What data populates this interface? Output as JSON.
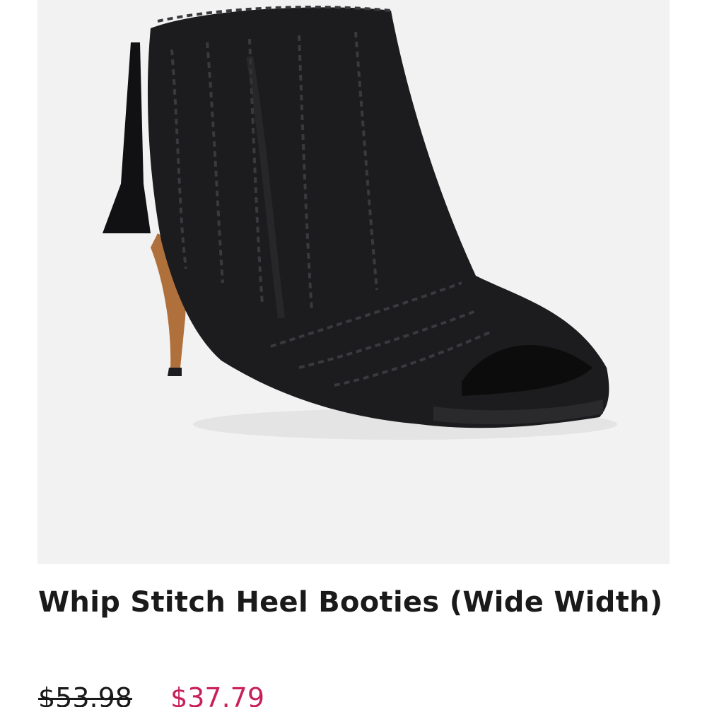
{
  "product": {
    "title": "Whip Stitch Heel Booties (Wide Width)",
    "image": {
      "name": "black-peep-toe-whip-stitch-bootie-image",
      "background_color": "#f2f2f2"
    },
    "price": {
      "original": "$53.98",
      "sale": "$37.79"
    }
  },
  "gallery": {
    "next_icon": "chevron-right-icon"
  },
  "colors": {
    "text": "#1a1a1a",
    "sale_price": "#c8205c",
    "boot_leather": "#1c1c1e",
    "heel_wood": "#b0703c"
  }
}
